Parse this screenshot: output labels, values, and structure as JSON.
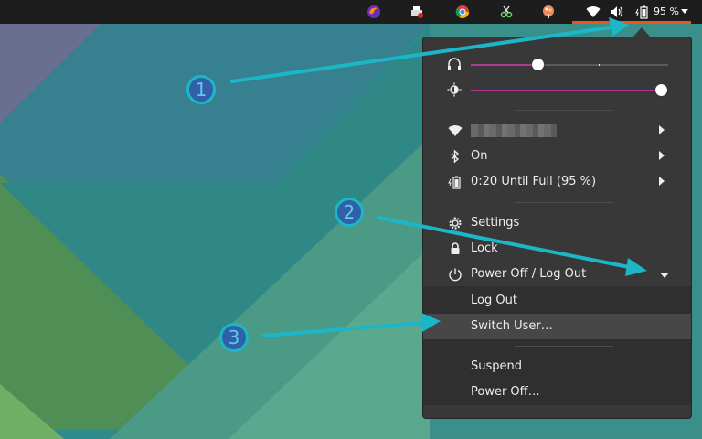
{
  "topbar": {
    "battery_percent_label": "95 %",
    "tray_icons": [
      "firefox-icon",
      "printer-icon",
      "chrome-icon",
      "scissors-icon",
      "paint-icon",
      "wifi-icon",
      "volume-icon",
      "battery-icon"
    ]
  },
  "menu": {
    "sliders": [
      {
        "name": "volume",
        "icon": "headphones-icon",
        "level": 0.36
      },
      {
        "name": "brightness",
        "icon": "brightness-icon",
        "level": 1.0
      }
    ],
    "network": {
      "icon": "wifi-icon",
      "ssid_obscured": true
    },
    "bluetooth": {
      "icon": "bluetooth-icon",
      "label": "On"
    },
    "battery": {
      "icon": "battery-icon",
      "label": "0:20 Until Full (95 %)"
    },
    "settings_label": "Settings",
    "lock_label": "Lock",
    "power_label": "Power Off / Log Out",
    "power_submenu": {
      "log_out_label": "Log Out",
      "switch_user_label": "Switch User…",
      "suspend_label": "Suspend",
      "power_off_label": "Power Off…"
    }
  },
  "annotations": [
    {
      "number": "1"
    },
    {
      "number": "2"
    },
    {
      "number": "3"
    }
  ],
  "colors": {
    "accent_orange": "#e95420",
    "annotation_cyan": "#1cb7c6",
    "annotation_fill": "#2f60a8",
    "slider_fill": "#b03a8f"
  }
}
